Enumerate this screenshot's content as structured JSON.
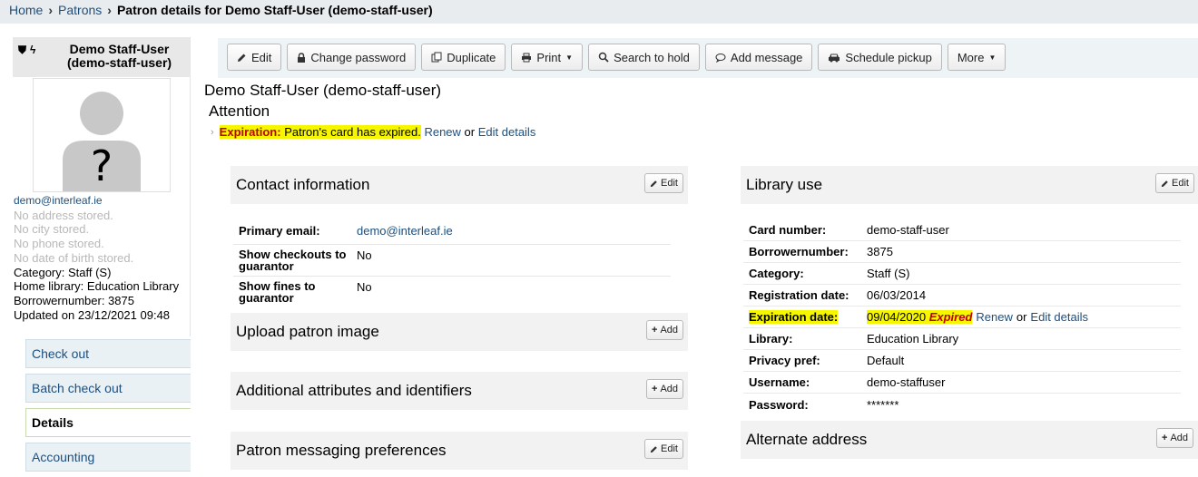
{
  "breadcrumb": {
    "home": "Home",
    "patrons": "Patrons",
    "current": "Patron details for Demo Staff-User (demo-staff-user)"
  },
  "patron_box": {
    "name": "Demo Staff-User (demo-staff-user)",
    "email": "demo@interleaf.ie",
    "address": "No address stored.",
    "city": "No city stored.",
    "phone": "No phone stored.",
    "dob": "No date of birth stored.",
    "category": "Category: Staff (S)",
    "home_library": "Home library: Education Library",
    "borrowernumber": "Borrowernumber: 3875",
    "updated": "Updated on 23/12/2021 09:48",
    "photo_placeholder": "?"
  },
  "menu": [
    "Check out",
    "Batch check out",
    "Details",
    "Accounting"
  ],
  "toolbar": {
    "edit": "Edit",
    "change_password": "Change password",
    "duplicate": "Duplicate",
    "print": "Print",
    "search_to_hold": "Search to hold",
    "add_message": "Add message",
    "schedule_pickup": "Schedule pickup",
    "more": "More"
  },
  "title": "Demo Staff-User (demo-staff-user)",
  "attention": {
    "heading": "Attention",
    "label": "Expiration:",
    "message": "Patron's card has expired.",
    "renew": "Renew",
    "or": "or",
    "edit_details": "Edit details"
  },
  "contact": {
    "heading": "Contact information",
    "edit": "Edit",
    "rows": [
      {
        "label": "Primary email:",
        "value": "demo@interleaf.ie"
      },
      {
        "label": "Show checkouts to guarantor",
        "value": "No"
      },
      {
        "label": "Show fines to guarantor",
        "value": "No"
      }
    ]
  },
  "upload_image": {
    "heading": "Upload patron image",
    "add": "Add"
  },
  "additional": {
    "heading": "Additional attributes and identifiers",
    "add": "Add"
  },
  "messaging": {
    "heading": "Patron messaging preferences",
    "edit": "Edit"
  },
  "library_use": {
    "heading": "Library use",
    "edit": "Edit",
    "rows": [
      {
        "label": "Card number:",
        "value": "demo-staff-user"
      },
      {
        "label": "Borrowernumber:",
        "value": "3875"
      },
      {
        "label": "Category:",
        "value": "Staff (S)"
      },
      {
        "label": "Registration date:",
        "value": "06/03/2014"
      },
      {
        "label": "Expiration date:",
        "value": "09/04/2020"
      },
      {
        "label": "Library:",
        "value": "Education Library"
      },
      {
        "label": "Privacy pref:",
        "value": "Default"
      },
      {
        "label": "Username:",
        "value": "demo-staffuser"
      },
      {
        "label": "Password:",
        "value": "*******"
      }
    ],
    "expired_label": "Expired",
    "renew": "Renew",
    "or": "or",
    "edit_details": "Edit details"
  },
  "alternate": {
    "heading": "Alternate address",
    "add": "Add"
  }
}
